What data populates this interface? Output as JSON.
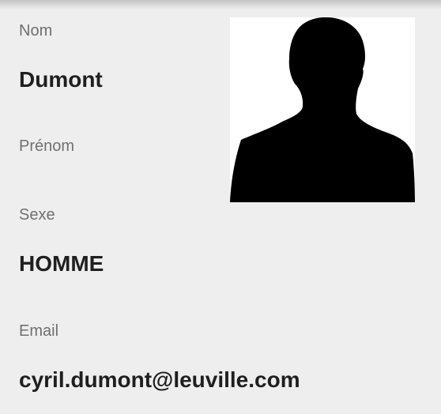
{
  "profile": {
    "nom_label": "Nom",
    "nom_value": "Dumont",
    "prenom_label": "Prénom",
    "prenom_value": "",
    "sexe_label": "Sexe",
    "sexe_value": "HOMME",
    "email_label": "Email",
    "email_value": "cyril.dumont@leuville.com",
    "photo_icon": "person-silhouette-icon"
  }
}
